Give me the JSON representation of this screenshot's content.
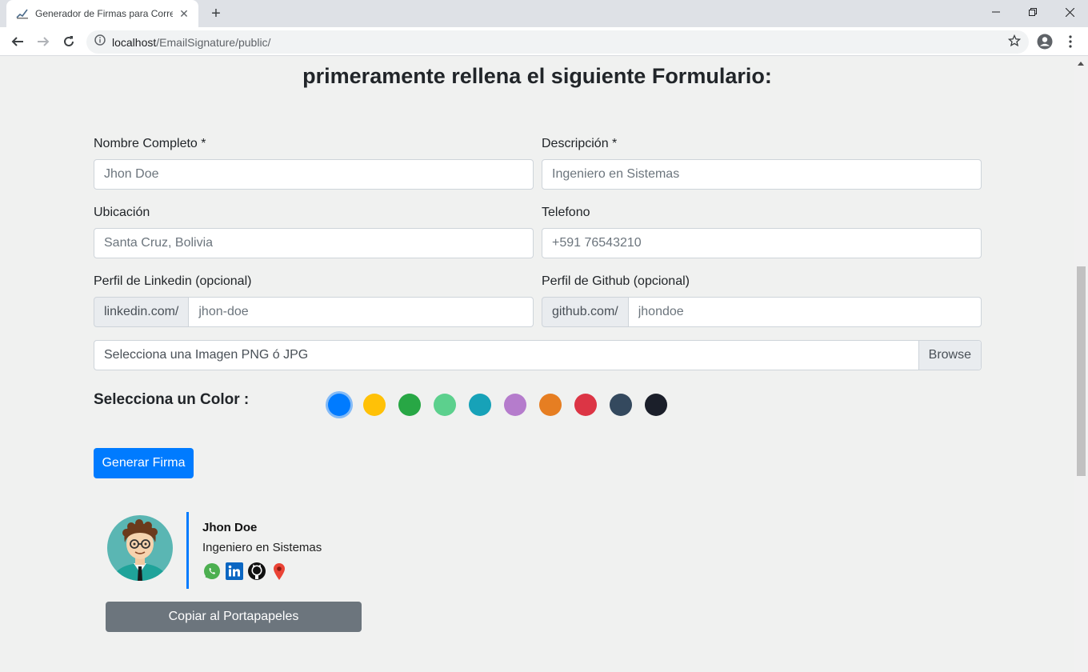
{
  "browser": {
    "tab_title": "Generador de Firmas para Correo",
    "url_host": "localhost",
    "url_path": "/EmailSignature/public/"
  },
  "page": {
    "heading": "primeramente rellena el siguiente Formulario:"
  },
  "form": {
    "nombre": {
      "label": "Nombre Completo *",
      "placeholder": "Jhon Doe"
    },
    "descripcion": {
      "label": "Descripción *",
      "placeholder": "Ingeniero en Sistemas"
    },
    "ubicacion": {
      "label": "Ubicación",
      "placeholder": "Santa Cruz, Bolivia"
    },
    "telefono": {
      "label": "Telefono",
      "placeholder": "+591 76543210"
    },
    "linkedin": {
      "label": "Perfil de Linkedin (opcional)",
      "prefix": "linkedin.com/",
      "placeholder": "jhon-doe"
    },
    "github": {
      "label": "Perfil de Github (opcional)",
      "prefix": "github.com/",
      "placeholder": "jhondoe"
    },
    "file": {
      "text": "Selecciona una Imagen PNG ó JPG",
      "browse": "Browse"
    },
    "color_label": "Selecciona un Color :",
    "colors": [
      "#007bff",
      "#ffc107",
      "#28a745",
      "#5cd08d",
      "#17a2b8",
      "#b57ccc",
      "#e67e22",
      "#dc3545",
      "#34495e",
      "#1b1f2a"
    ],
    "selected_color": "#007bff",
    "submit": "Generar Firma"
  },
  "signature": {
    "name": "Jhon Doe",
    "description": "Ingeniero en Sistemas",
    "icons": [
      "whatsapp-icon",
      "linkedin-icon",
      "github-icon",
      "location-pin-icon"
    ],
    "copy_button": "Copiar al Portapapeles"
  }
}
